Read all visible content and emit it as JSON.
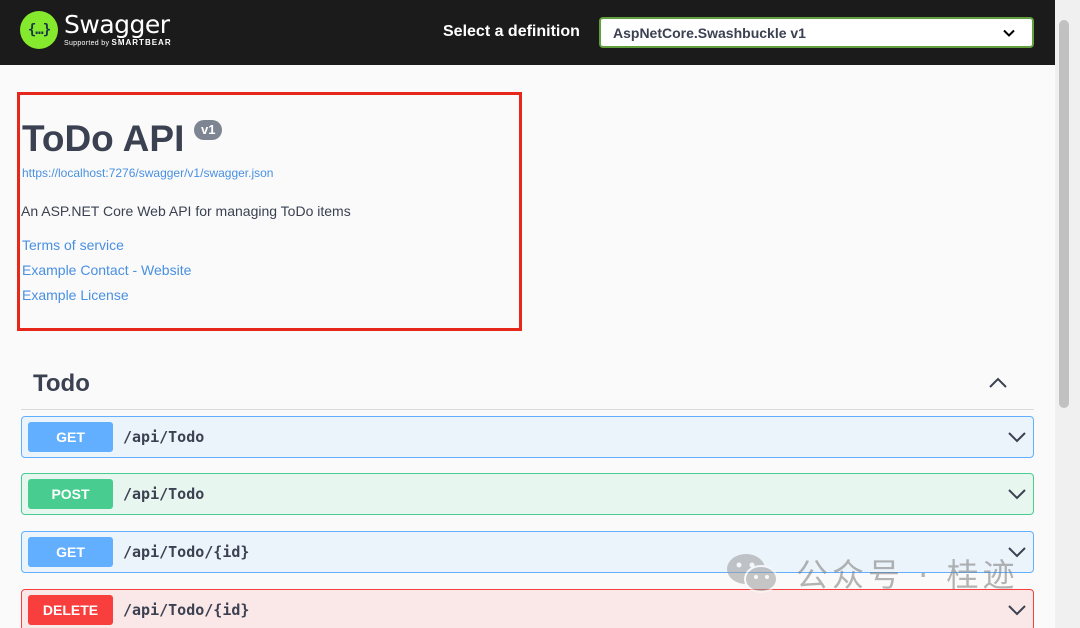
{
  "header": {
    "brand": "Swagger",
    "brand_sub_prefix": "Supported by",
    "brand_sub_company": "SMARTBEAR",
    "definition_label": "Select a definition",
    "definition_selected": "AspNetCore.Swashbuckle v1"
  },
  "info": {
    "title": "ToDo API",
    "version": "v1",
    "spec_url": "https://localhost:7276/swagger/v1/swagger.json",
    "description": "An ASP.NET Core Web API for managing ToDo items",
    "links": [
      "Terms of service",
      "Example Contact - Website",
      "Example License"
    ]
  },
  "tag": {
    "name": "Todo"
  },
  "operations": [
    {
      "method": "GET",
      "path": "/api/Todo"
    },
    {
      "method": "POST",
      "path": "/api/Todo"
    },
    {
      "method": "GET",
      "path": "/api/Todo/{id}"
    },
    {
      "method": "DELETE",
      "path": "/api/Todo/{id}"
    }
  ],
  "watermark": {
    "text": "公众号 · 桂迹"
  },
  "colors": {
    "get": "#61affe",
    "post": "#49cc90",
    "delete": "#f93e3e",
    "link": "#4990e2",
    "highlight_box": "#e8271b"
  }
}
